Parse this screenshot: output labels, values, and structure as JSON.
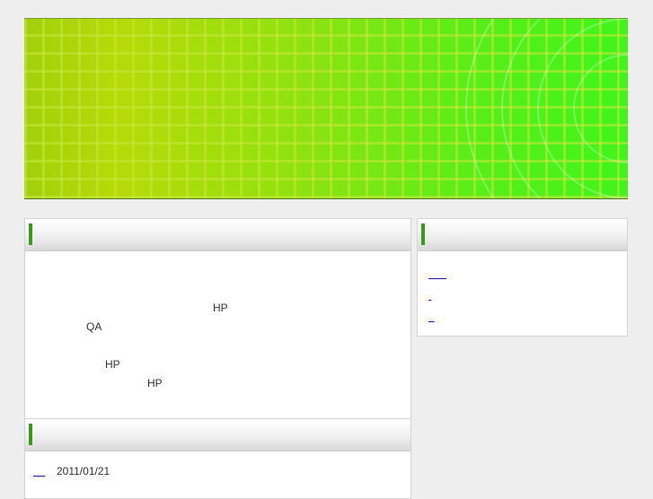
{
  "main_panel": {
    "title": "",
    "lines": [
      "HP",
      "QA",
      "HP",
      "HP"
    ]
  },
  "side_panel": {
    "title": "",
    "links": [
      "      ",
      " ",
      "  "
    ]
  },
  "news_panel": {
    "title": "",
    "item_link": "    ",
    "item_date": "2011/01/21"
  }
}
